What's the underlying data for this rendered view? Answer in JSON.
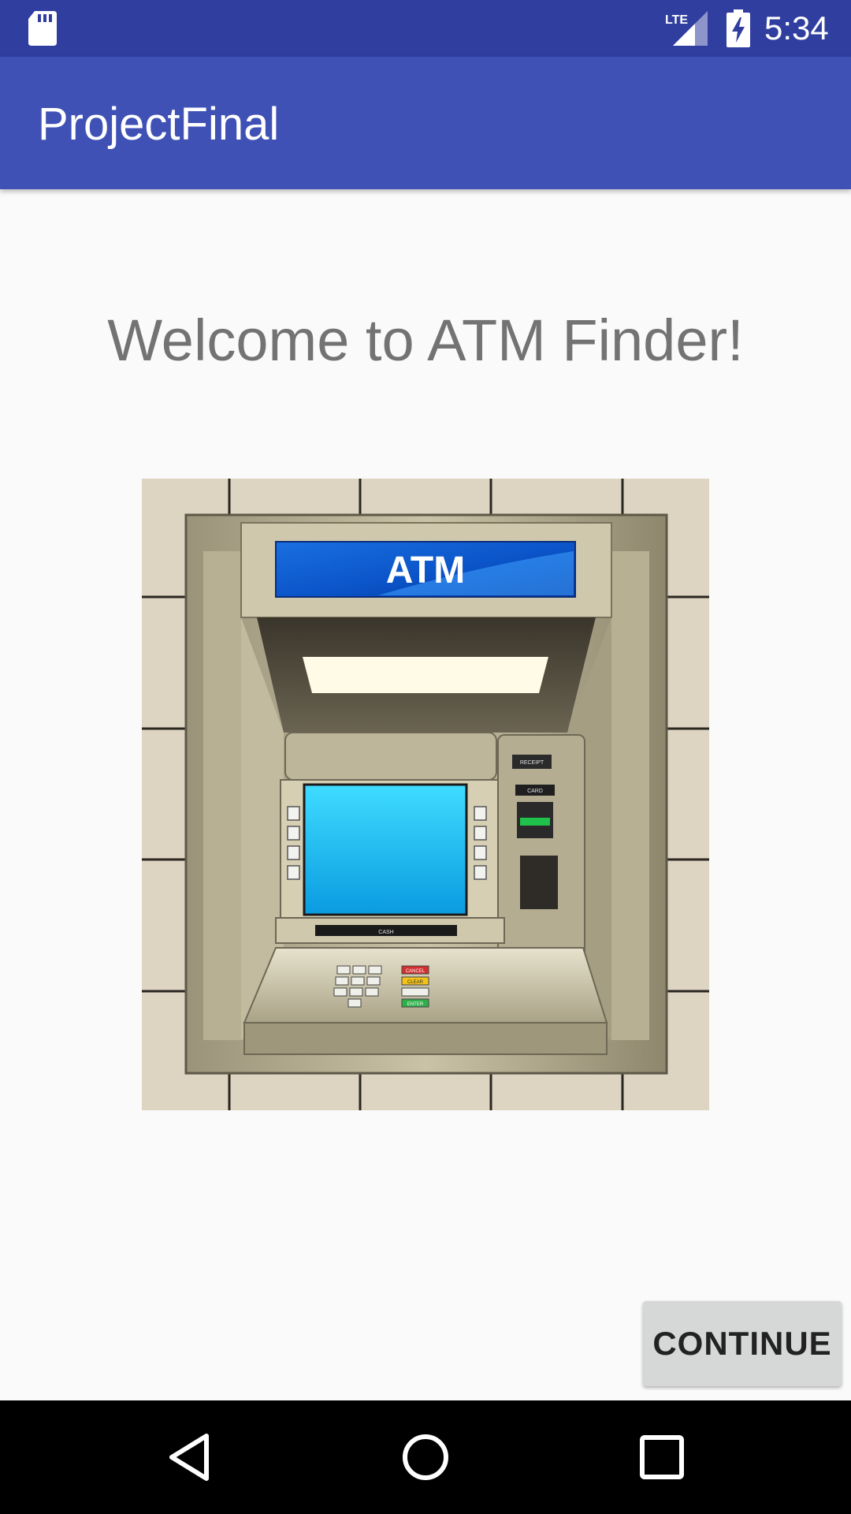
{
  "status_bar": {
    "time": "5:34",
    "network_label": "LTE",
    "icons": [
      "sd-card-icon",
      "signal-icon",
      "battery-charging-icon"
    ]
  },
  "app_bar": {
    "title": "ProjectFinal"
  },
  "main": {
    "welcome_text": "Welcome to ATM Finder!",
    "image": {
      "name": "atm-machine-illustration",
      "sign_text": "ATM",
      "receipt_label": "RECEIPT",
      "card_label": "CARD",
      "cash_label": "CASH",
      "cancel_label": "CANCEL",
      "clear_label": "CLEAR",
      "enter_label": "ENTER"
    },
    "continue_label": "CONTINUE"
  },
  "nav_bar": {
    "icons": [
      "back-icon",
      "home-icon",
      "recents-icon"
    ]
  },
  "colors": {
    "status_bar": "#303f9f",
    "app_bar": "#3f51b5",
    "background": "#fafafa",
    "button": "#d6d7d7",
    "welcome_text": "#737373"
  }
}
